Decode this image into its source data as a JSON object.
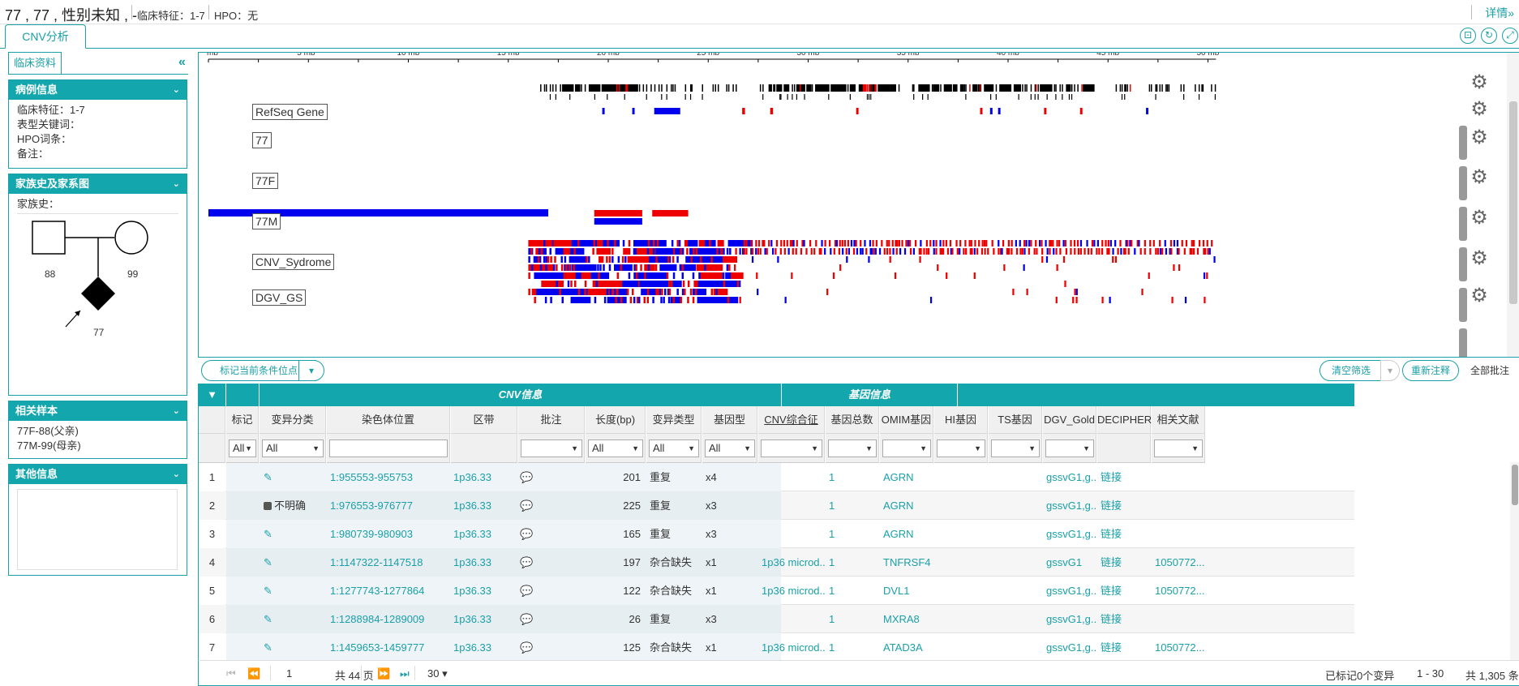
{
  "header": {
    "title": "77 , 77 , 性别未知 , -",
    "clinical": "临床特征：1-7",
    "hpo": "HPO：无",
    "detail_link": "详情»"
  },
  "tabs": {
    "cnv": "CNV分析"
  },
  "left": {
    "tab": "临床资料",
    "case_info": {
      "title": "病例信息",
      "clinical": "临床特征：1-7",
      "phenotype": "表型关键词：",
      "hpo": "HPO词条：",
      "note": "备注："
    },
    "family": {
      "title": "家族史及家系图",
      "history": "家族史：",
      "father": "88",
      "mother": "99",
      "proband": "77"
    },
    "related": {
      "title": "相关样本",
      "items": [
        "77F-88(父亲)",
        "77M-99(母亲)"
      ]
    },
    "other": {
      "title": "其他信息"
    }
  },
  "viz": {
    "axis_ticks": [
      "mb",
      "5 mb",
      "10 mb",
      "15 mb",
      "20 mb",
      "25 mb",
      "30 mb",
      "35 mb",
      "40 mb",
      "45 mb",
      "50 mb"
    ],
    "tracks": [
      "RefSeq Gene",
      "77",
      "77F",
      "77M",
      "CNV_Sydrome",
      "DGV_GS"
    ],
    "colors": {
      "gain": "#0000ee",
      "loss": "#ee0000",
      "gene": "#000000",
      "teal": "#13a7ad"
    }
  },
  "toolbar": {
    "mark_btn": "标记当前条件位点",
    "clear_filter": "清空筛选",
    "reannotate": "重新注释",
    "annotate_all": "全部批注"
  },
  "grid": {
    "group_cnv": "CNV信息",
    "group_gene": "基因信息",
    "columns": [
      "标记",
      "变异分类",
      "染色体位置",
      "区带",
      "批注",
      "长度(bp)",
      "变异类型",
      "基因型",
      "CNV综合征",
      "基因总数",
      "OMIM基因",
      "HI基因",
      "TS基因",
      "DGV_Gold",
      "DECIPHER",
      "相关文献"
    ],
    "filters": {
      "all": "All"
    },
    "rows": [
      {
        "n": "1",
        "cls": "",
        "pos": "1:955553-955753",
        "band": "1p36.33",
        "len": "201",
        "type": "重复",
        "gt": "x4",
        "syn": "",
        "total": "1",
        "omim": "AGRN",
        "dgv": "gssvG1,g...",
        "dec": "链接",
        "lit": ""
      },
      {
        "n": "2",
        "cls": "不明确",
        "pos": "1:976553-976777",
        "band": "1p36.33",
        "len": "225",
        "type": "重复",
        "gt": "x3",
        "syn": "",
        "total": "1",
        "omim": "AGRN",
        "dgv": "gssvG1,g...",
        "dec": "链接",
        "lit": ""
      },
      {
        "n": "3",
        "cls": "",
        "pos": "1:980739-980903",
        "band": "1p36.33",
        "len": "165",
        "type": "重复",
        "gt": "x3",
        "syn": "",
        "total": "1",
        "omim": "AGRN",
        "dgv": "gssvG1,g...",
        "dec": "链接",
        "lit": ""
      },
      {
        "n": "4",
        "cls": "",
        "pos": "1:1147322-1147518",
        "band": "1p36.33",
        "len": "197",
        "type": "杂合缺失",
        "gt": "x1",
        "syn": "1p36 microd...",
        "total": "1",
        "omim": "TNFRSF4",
        "dgv": "gssvG1",
        "dec": "链接",
        "lit": "1050772..."
      },
      {
        "n": "5",
        "cls": "",
        "pos": "1:1277743-1277864",
        "band": "1p36.33",
        "len": "122",
        "type": "杂合缺失",
        "gt": "x1",
        "syn": "1p36 microd...",
        "total": "1",
        "omim": "DVL1",
        "dgv": "gssvG1,g...",
        "dec": "链接",
        "lit": "1050772..."
      },
      {
        "n": "6",
        "cls": "",
        "pos": "1:1288984-1289009",
        "band": "1p36.33",
        "len": "26",
        "type": "重复",
        "gt": "x3",
        "syn": "",
        "total": "1",
        "omim": "MXRA8",
        "dgv": "gssvG1,g...",
        "dec": "链接",
        "lit": ""
      },
      {
        "n": "7",
        "cls": "",
        "pos": "1:1459653-1459777",
        "band": "1p36.33",
        "len": "125",
        "type": "杂合缺失",
        "gt": "x1",
        "syn": "1p36 microd...",
        "total": "1",
        "omim": "ATAD3A",
        "dgv": "gssvG1,g...",
        "dec": "链接",
        "lit": "1050772..."
      }
    ]
  },
  "pager": {
    "page": "1",
    "total_pages": "共 44 页",
    "page_size": "30 ▾",
    "marked": "已标记0个变异",
    "range": "1 - 30",
    "total": "共 1,305 条"
  }
}
